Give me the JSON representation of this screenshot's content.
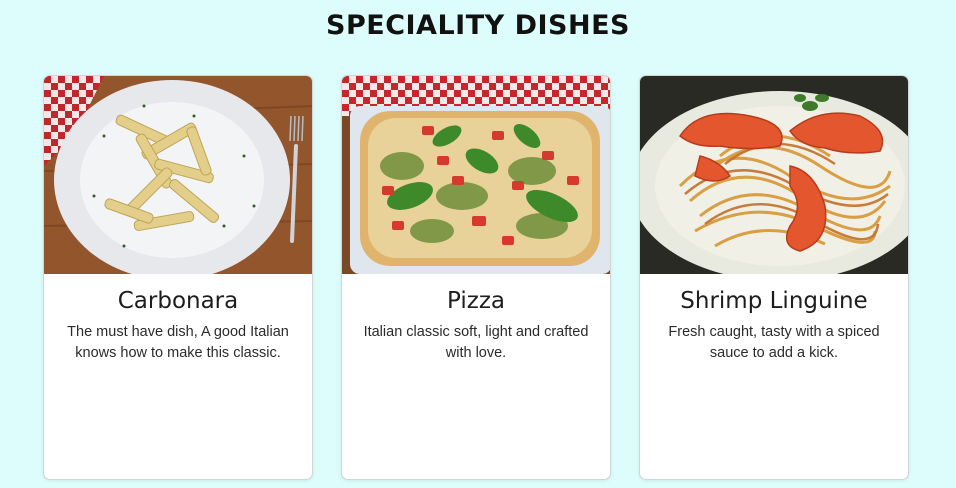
{
  "section": {
    "title": "SPECIALITY DISHES"
  },
  "cards": [
    {
      "title": "Carbonara",
      "text": "The must have dish, A good Italian knows how to make this classic.",
      "image": "carbonara-photo"
    },
    {
      "title": "Pizza",
      "text": "Italian classic soft, light and crafted with love.",
      "image": "pizza-photo"
    },
    {
      "title": "Shrimp Linguine",
      "text": "Fresh caught, tasty with a spiced sauce to add a kick.",
      "image": "shrimp-linguine-photo"
    }
  ],
  "colors": {
    "page_background": "#dcfdfb",
    "card_background": "#ffffff"
  }
}
